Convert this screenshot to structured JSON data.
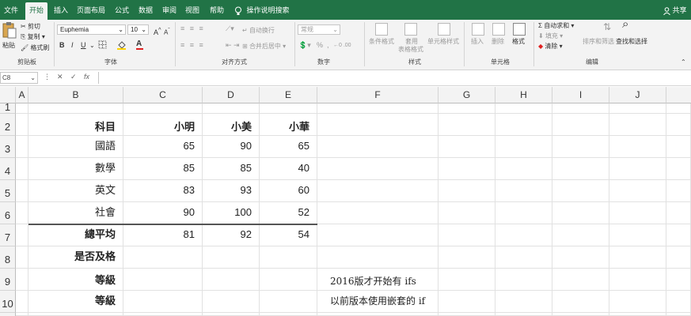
{
  "tabs": [
    "文件",
    "开始",
    "插入",
    "页面布局",
    "公式",
    "数据",
    "审阅",
    "视图",
    "帮助"
  ],
  "tell_me": "操作说明搜索",
  "share": "共享",
  "ribbon": {
    "clipboard": {
      "paste": "粘贴",
      "cut": "剪切",
      "copy": "复制",
      "format_painter": "格式刷",
      "label": "剪贴板"
    },
    "font": {
      "name": "Euphemia",
      "size": "10",
      "bold": "B",
      "italic": "I",
      "underline": "U",
      "font_color": "A",
      "grow": "A",
      "shrink": "A",
      "label": "字体"
    },
    "alignment": {
      "wrap": "自动换行",
      "merge": "合并后居中",
      "label": "对齐方式"
    },
    "number": {
      "format": "常规",
      "percent": "%",
      "comma": ",",
      "label": "数字"
    },
    "styles": {
      "conditional": "条件格式",
      "table": "套用",
      "table2": "表格格式",
      "cell_styles": "单元格样式",
      "label": "样式"
    },
    "cells": {
      "insert": "插入",
      "delete": "删除",
      "format": "格式",
      "label": "单元格"
    },
    "editing": {
      "autosum": "自动求和",
      "fill": "填充",
      "clear": "清除",
      "sort": "排序和筛选",
      "find": "查找和选择",
      "label": "编辑"
    }
  },
  "formula_bar": {
    "name_box": "C8",
    "cancel": "✕",
    "enter": "✓",
    "fx": "fx"
  },
  "columns": [
    "A",
    "B",
    "C",
    "D",
    "E",
    "F",
    "G",
    "H",
    "I",
    "J"
  ],
  "rows": [
    "1",
    "2",
    "3",
    "4",
    "5",
    "6",
    "7",
    "8",
    "9",
    "10"
  ],
  "sheet": {
    "header": {
      "subject": "科目",
      "p1": "小明",
      "p2": "小美",
      "p3": "小華"
    },
    "data": [
      {
        "subject": "國語",
        "p1": "65",
        "p2": "90",
        "p3": "65"
      },
      {
        "subject": "數學",
        "p1": "85",
        "p2": "85",
        "p3": "40"
      },
      {
        "subject": "英文",
        "p1": "83",
        "p2": "93",
        "p3": "60"
      },
      {
        "subject": "社會",
        "p1": "90",
        "p2": "100",
        "p3": "52"
      }
    ],
    "avg": {
      "label": "總平均",
      "p1": "81",
      "p2": "92",
      "p3": "54"
    },
    "pass_label": "是否及格",
    "grade_label_1": "等級",
    "grade_label_2": "等級",
    "note_1": "2016版才开始有 ifs",
    "note_2": "以前版本使用嵌套的 if"
  },
  "colors": {
    "excel_green": "#217346",
    "font_red": "#e02020"
  }
}
